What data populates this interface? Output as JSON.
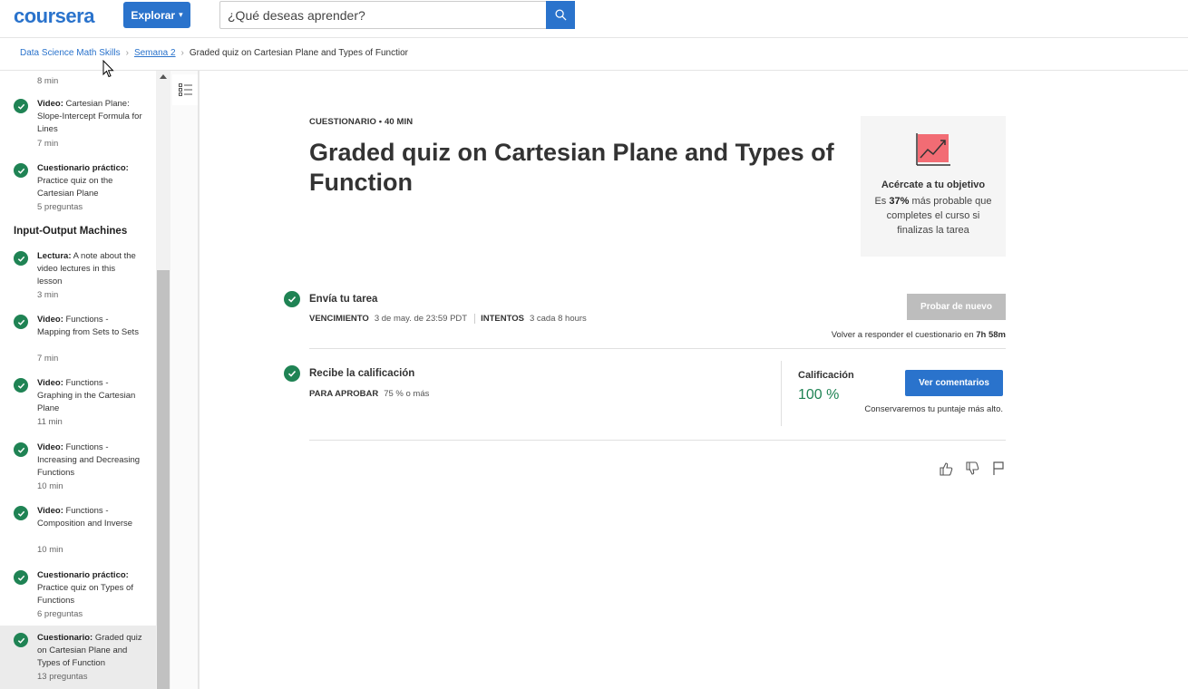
{
  "header": {
    "logo": "coursera",
    "explore_label": "Explorar",
    "search_placeholder": "¿Qué deseas aprender?"
  },
  "breadcrumb": {
    "items": [
      "Data Science Math Skills",
      "Semana 2",
      "Graded quiz on Cartesian Plane and Types of Functior"
    ]
  },
  "sidebar": {
    "top_meta": "8 min",
    "section_title": "Input-Output Machines",
    "items": [
      {
        "type": "Video:",
        "title": "Cartesian Plane: Slope-Intercept Formula for Lines",
        "meta": "7 min"
      },
      {
        "type": "Cuestionario práctico:",
        "title": "Practice quiz on the Cartesian Plane",
        "meta": "5 preguntas"
      },
      {
        "type": "Lectura:",
        "title": "A note about the video lectures in this lesson",
        "meta": "3 min"
      },
      {
        "type": "Video:",
        "title": "Functions - Mapping from Sets to Sets",
        "meta": "7 min"
      },
      {
        "type": "Video:",
        "title": "Functions - Graphing in the Cartesian Plane",
        "meta": "11 min"
      },
      {
        "type": "Video:",
        "title": "Functions - Increasing and Decreasing Functions",
        "meta": "10 min"
      },
      {
        "type": "Video:",
        "title": "Functions - Composition and Inverse",
        "meta": "10 min"
      },
      {
        "type": "Cuestionario práctico:",
        "title": "Practice quiz on Types of Functions",
        "meta": "6 preguntas"
      },
      {
        "type": "Cuestionario:",
        "title": "Graded quiz on Cartesian Plane and Types of Function",
        "meta": "13 preguntas"
      }
    ]
  },
  "main": {
    "kicker": "CUESTIONARIO • 40 MIN",
    "title": "Graded quiz on Cartesian Plane and Types of Function",
    "goal": {
      "title": "Acércate a tu objetivo",
      "pre": "Es",
      "percent": "37%",
      "post": "más probable que completes el curso si finalizas la tarea"
    },
    "submit": {
      "title": "Envía tu tarea",
      "due_label": "VENCIMIENTO",
      "due_value": "3 de may. de 23:59 PDT",
      "attempts_label": "INTENTOS",
      "attempts_value": "3 cada 8 hours",
      "retry_button": "Probar de nuevo",
      "retry_note": "Volver a responder el cuestionario en",
      "retry_time": "7h 58m"
    },
    "grade": {
      "title": "Recibe la calificación",
      "pass_label": "PARA APROBAR",
      "pass_value": "75 % o más",
      "grade_label": "Calificación",
      "grade_value": "100 %",
      "feedback_button": "Ver comentarios",
      "keep_note": "Conservaremos tu puntaje más alto."
    },
    "feedback_icons": [
      "thumbs-up-icon",
      "thumbs-down-icon",
      "flag-icon"
    ]
  },
  "colors": {
    "brand": "#2a73cc",
    "success": "#1f8354",
    "disabled": "#bdbdbd"
  }
}
